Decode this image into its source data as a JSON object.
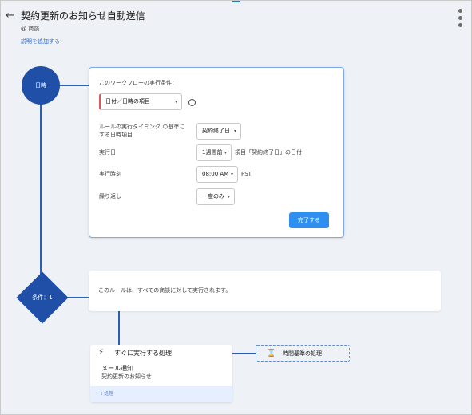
{
  "header": {
    "back_arrow": "←",
    "title": "契約更新のお知らせ自動送信",
    "object_prefix": "@",
    "object_name": "商談",
    "add_description": "説明を追加する"
  },
  "flow": {
    "trigger_node_label": "日時",
    "condition_node_label": "条件：1"
  },
  "trigger_card": {
    "heading": "このワークフローの実行条件：",
    "trigger_type": "日付／日時の項目",
    "info_icon": "!",
    "timing_label": "ルールの実行タイミング の基準にする日時項目",
    "reference_field": "契約終了日",
    "date_label": "実行日",
    "offset_value": "1週間前",
    "date_suffix": "項目「契約終了日」の日付",
    "time_label": "実行時刻",
    "time_value": "08:00 AM",
    "timezone": "PST",
    "repeat_label": "繰り返し",
    "repeat_value": "一度のみ",
    "done_button": "完了する"
  },
  "rule": {
    "text": "このルールは、すべての商談に対して実行されます。"
  },
  "action_card": {
    "title": "すぐに実行する処理",
    "item_title": "メール通知",
    "item_subtitle": "契約更新のお知らせ",
    "add_process": "+処理"
  },
  "time_based": {
    "label": "時間基準の処理"
  },
  "icons": {
    "dropdown": "▾",
    "action": "⚡",
    "time": "⌛"
  },
  "colors": {
    "node": "#1f4fa6",
    "connector": "#2c5fb9",
    "primary_button": "#2e8ff0",
    "link": "#2f6fd6",
    "required_marker": "#e05656",
    "canvas": "#eef1f6"
  }
}
